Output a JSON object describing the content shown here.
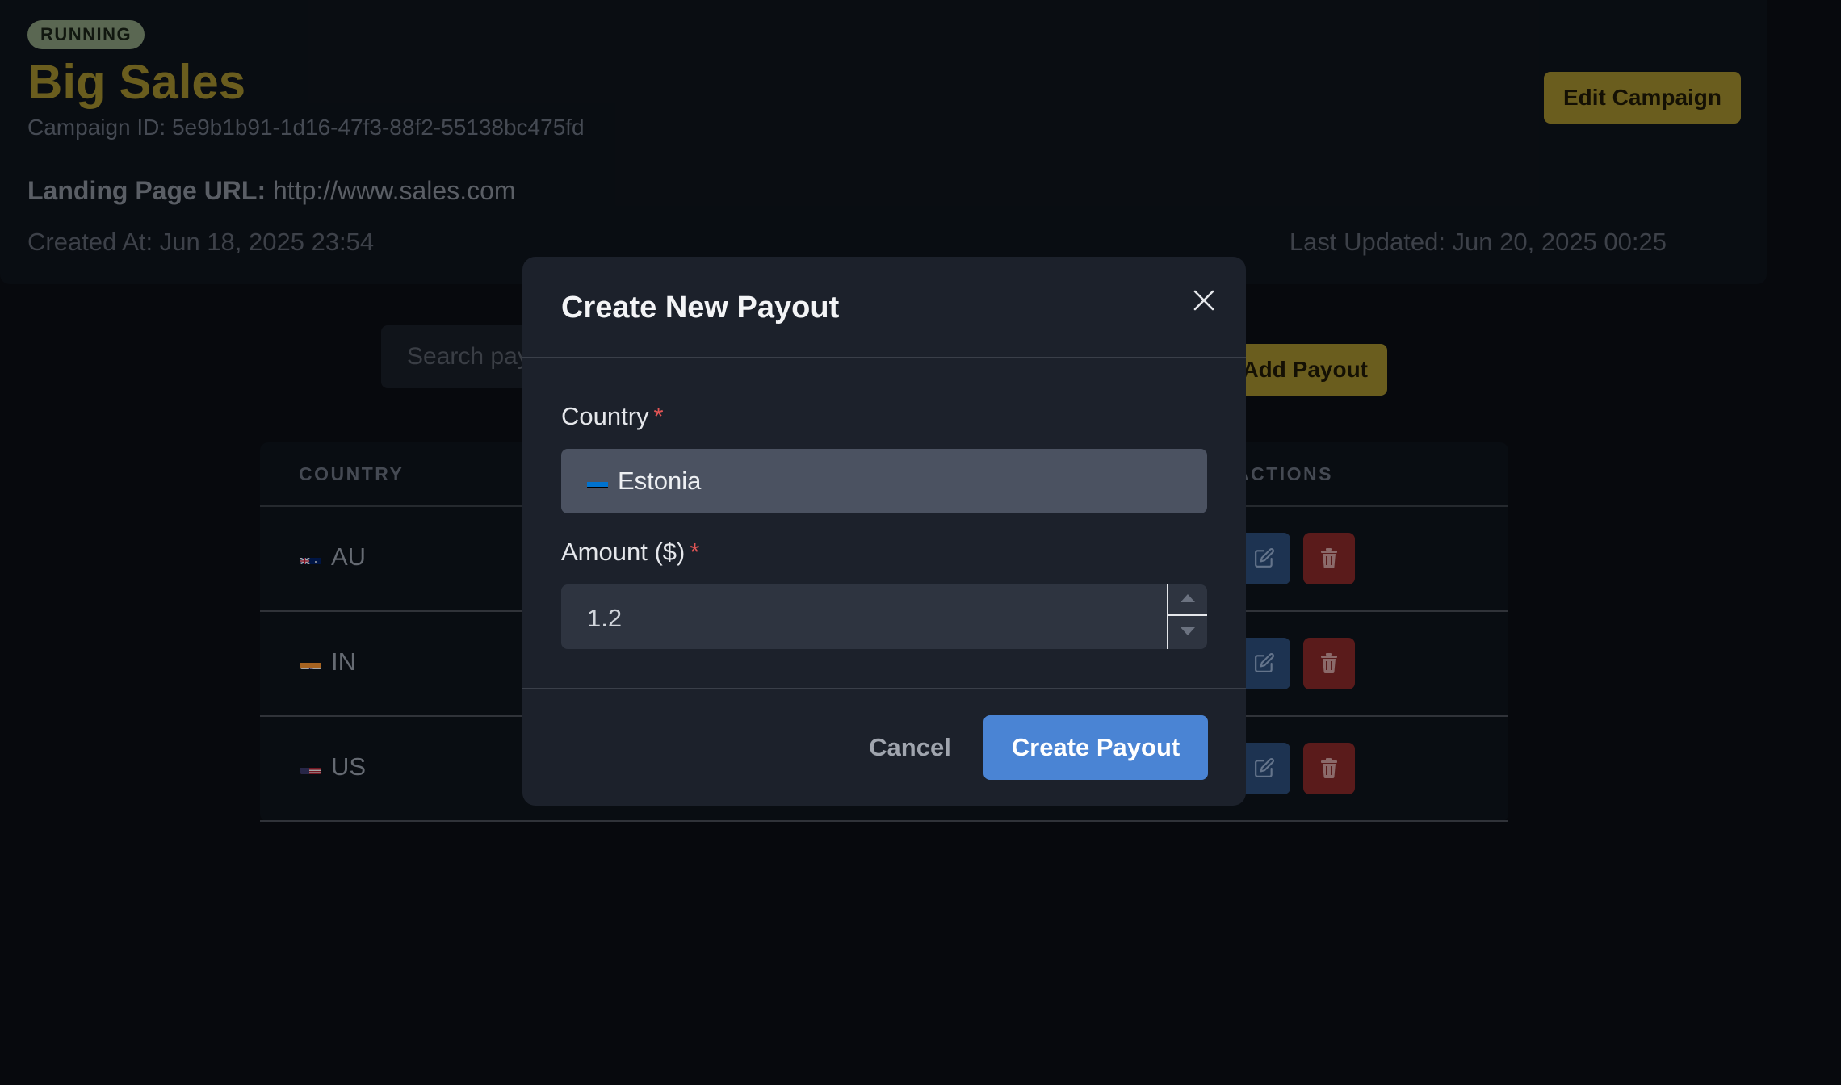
{
  "campaign": {
    "status": "RUNNING",
    "title": "Big Sales",
    "id_text": "Campaign ID: 5e9b1b91-1d16-47f3-88f2-55138bc475fd",
    "landing_label": "Landing Page URL:",
    "landing_url": "http://www.sales.com",
    "created_at": "Created At: Jun 18, 2025 23:54",
    "last_updated": "Last Updated: Jun 20, 2025 00:25",
    "edit_label": "Edit Campaign"
  },
  "toolbar": {
    "search_placeholder": "Search payouts...",
    "add_label": "Add Payout"
  },
  "table": {
    "headers": {
      "country": "COUNTRY",
      "actions": "ACTIONS"
    },
    "rows": [
      {
        "country": "AU",
        "flag": "au-flag-icon"
      },
      {
        "country": "IN",
        "flag": "in-flag-icon"
      },
      {
        "country": "US",
        "flag": "us-flag-icon"
      }
    ]
  },
  "modal": {
    "title": "Create New Payout",
    "country_label": "Country",
    "country_value": "Estonia",
    "country_flag": "ee-flag-icon",
    "amount_label": "Amount ($)",
    "amount_value": "1.2",
    "required_mark": "*",
    "cancel_label": "Cancel",
    "create_label": "Create Payout"
  },
  "colors": {
    "accent": "#a3902e",
    "primary": "#4a84d4",
    "danger": "#8a2a2a",
    "edit": "#2d4f7d",
    "status_badge": "#8a9e7f"
  }
}
